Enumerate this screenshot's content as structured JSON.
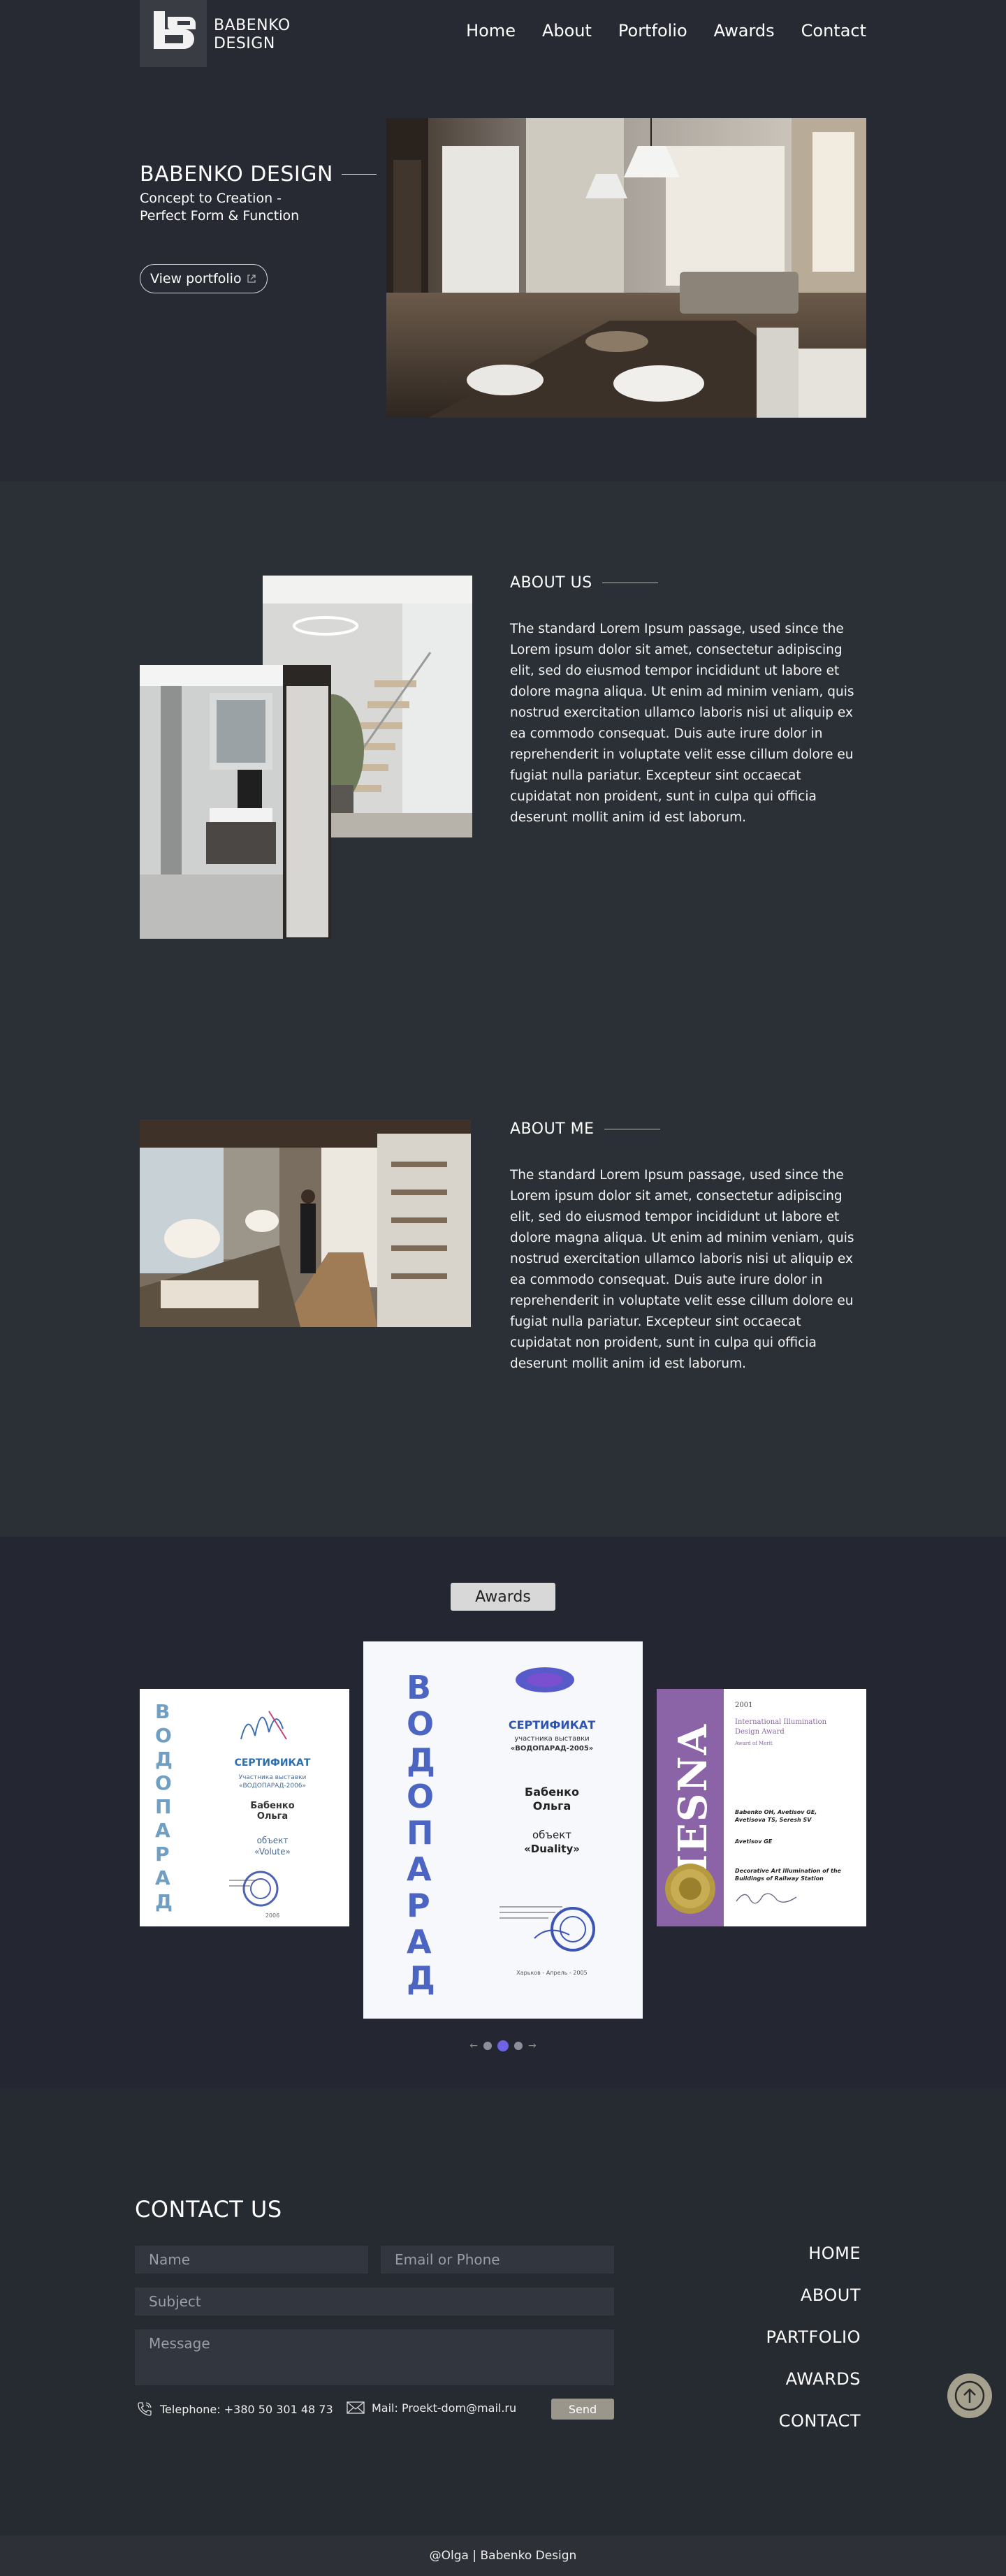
{
  "brand": {
    "name_line1": "BABENKO",
    "name_line2": "DESIGN",
    "logo_letters": "ba"
  },
  "nav": {
    "items": [
      {
        "label": "Home"
      },
      {
        "label": "About"
      },
      {
        "label": "Portfolio"
      },
      {
        "label": "Awards"
      },
      {
        "label": "Contact"
      }
    ]
  },
  "hero": {
    "title": "BABENKO DESIGN",
    "subtitle": "Concept to Creation - Perfect Form & Function",
    "button_label": "View portfolio",
    "button_icon": "external-link-icon"
  },
  "about_us": {
    "heading": "ABOUT US",
    "body": "The standard Lorem Ipsum passage, used since the Lorem ipsum dolor sit amet, consectetur adipiscing elit, sed do eiusmod tempor incididunt ut labore et dolore magna aliqua. Ut enim ad minim veniam, quis nostrud exercitation ullamco laboris nisi ut aliquip ex ea commodo consequat. Duis aute irure dolor in reprehenderit in voluptate velit esse cillum dolore eu fugiat nulla pariatur. Excepteur sint occaecat cupidatat non proident, sunt in culpa qui officia deserunt mollit anim id est laborum."
  },
  "about_me": {
    "heading": "ABOUT ME",
    "body": "The standard Lorem Ipsum passage, used since the Lorem ipsum dolor sit amet, consectetur adipiscing elit, sed do eiusmod tempor incididunt ut labore et dolore magna aliqua. Ut enim ad minim veniam, quis nostrud exercitation ullamco laboris nisi ut aliquip ex ea commodo consequat. Duis aute irure dolor in reprehenderit in voluptate velit esse cillum dolore eu fugiat nulla pariatur. Excepteur sint occaecat cupidatat non proident, sunt in culpa qui officia deserunt mollit anim id est laborum."
  },
  "awards": {
    "heading": "Awards",
    "certificate_left": {
      "vertical_word": "ВОДОПАРАД",
      "title": "СЕРТИФИКАТ",
      "line1": "Участника выставки",
      "line2": "«ВОДОПАРАД-2006»",
      "name": "Бабенко Ольга",
      "object_label": "объект",
      "object_name": "«Volute»",
      "year": "2006"
    },
    "certificate_center": {
      "vertical_word": "ВОДОПАРАД",
      "title": "СЕРТИФИКАТ",
      "line1": "участника выставки",
      "line2": "«ВОДОПАРАД-2005»",
      "name_line1": "Бабенко",
      "name_line2": "Ольга",
      "object_label": "объект",
      "object_name": "«Duality»",
      "footer_line": "Харьков - Апрель - 2005"
    },
    "certificate_right": {
      "year": "2001",
      "title_line1": "International Illumination",
      "title_line2": "Design Award",
      "subtitle": "Award of Merit",
      "side_word": "IESNA",
      "recipient_line1": "Babenko OH, Avetisov GE,",
      "recipient_line2": "Avetisova TS, Seresh SV",
      "designer": "Avetisov GE",
      "project_line1": "Decorative Art Illumination of the",
      "project_line2": "Buildings of Railway Station"
    },
    "carousel": {
      "prev": "←",
      "next": "→",
      "active_index": 1,
      "count": 3
    }
  },
  "contact": {
    "heading": "CONTACT US",
    "name_placeholder": "Name",
    "email_placeholder": "Email or Phone",
    "subject_placeholder": "Subject",
    "message_placeholder": "Message",
    "telephone": "Telephone: +380 50 301 48 73",
    "mail": "Mail: Proekt-dom@mail.ru",
    "send_label": "Send"
  },
  "footer_nav": {
    "items": [
      {
        "label": "HOME"
      },
      {
        "label": "ABOUT"
      },
      {
        "label": "PARTFOLIO"
      },
      {
        "label": "AWARDS"
      },
      {
        "label": "CONTACT"
      }
    ]
  },
  "footer": {
    "text": "@Olga | Babenko Design"
  },
  "colors": {
    "page_bg": "#2a2d36",
    "accent_purple": "#6e63e6",
    "send_button": "#9b968b",
    "scroll_top": "#a6a08f"
  }
}
